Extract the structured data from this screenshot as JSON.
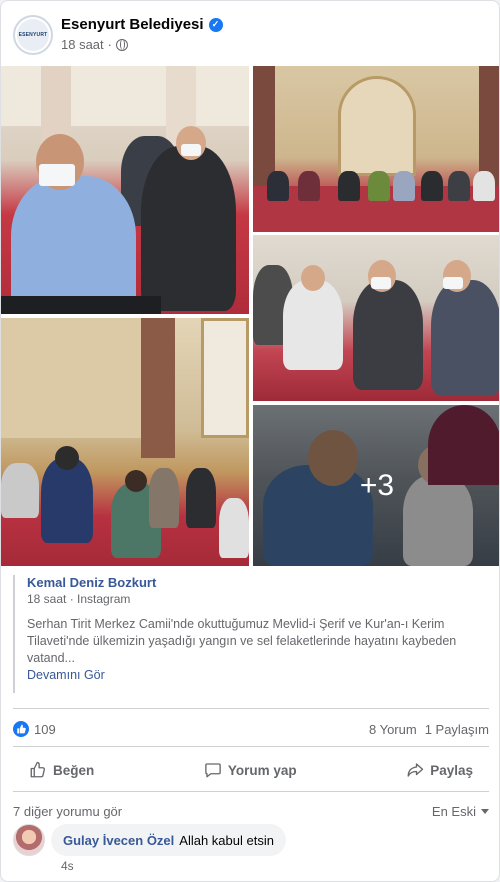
{
  "post": {
    "page_name": "Esenyurt Belediyesi",
    "time": "18 saat",
    "separator": "·",
    "avatar_text": "ESENYURT"
  },
  "photos": {
    "more_count": "+3"
  },
  "shared": {
    "author": "Kemal Deniz Bozkurt",
    "meta": "18 saat · Instagram",
    "text": "Serhan Tirit Merkez Camii'nde okuttuğumuz Mevlid-i Şerif ve Kur'an-ı Kerim Tilaveti'nde ülkemizin yaşadığı yangın ve sel felaketlerinde hayatını kaybeden vatand...",
    "see_more": "Devamını Gör"
  },
  "stats": {
    "likes": "109",
    "comments": "8 Yorum",
    "shares": "1 Paylaşım"
  },
  "actions": {
    "like": "Beğen",
    "comment": "Yorum yap",
    "share": "Paylaş"
  },
  "comments": {
    "view_more": "7 diğer yorumu gör",
    "sort": "En Eski",
    "items": [
      {
        "author": "Gulay İvecen Özel",
        "text": "Allah kabul etsin",
        "time": "4s"
      }
    ]
  },
  "colors": {
    "brand_blue": "#1877f2",
    "link_blue": "#385898",
    "muted": "#65676b"
  }
}
